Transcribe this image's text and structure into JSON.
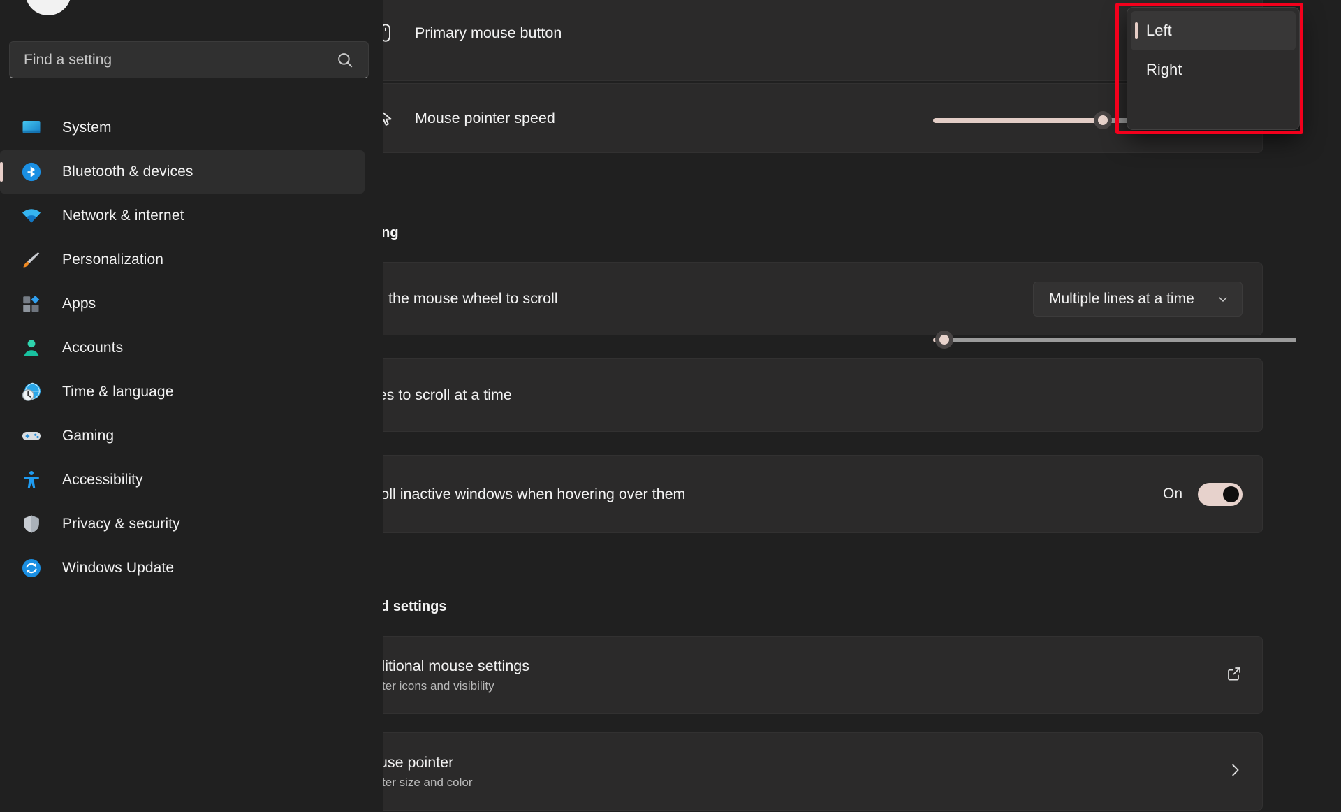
{
  "search": {
    "placeholder": "Find a setting",
    "value": "",
    "icon": "search-icon"
  },
  "sidebar": {
    "items": [
      {
        "label": "System",
        "icon": "system-icon",
        "active": false
      },
      {
        "label": "Bluetooth & devices",
        "icon": "bluetooth-icon",
        "active": true
      },
      {
        "label": "Network & internet",
        "icon": "network-icon",
        "active": false
      },
      {
        "label": "Personalization",
        "icon": "brush-icon",
        "active": false
      },
      {
        "label": "Apps",
        "icon": "apps-icon",
        "active": false
      },
      {
        "label": "Accounts",
        "icon": "account-icon",
        "active": false
      },
      {
        "label": "Time & language",
        "icon": "clock-globe-icon",
        "active": false
      },
      {
        "label": "Gaming",
        "icon": "gamepad-icon",
        "active": false
      },
      {
        "label": "Accessibility",
        "icon": "accessibility-icon",
        "active": false
      },
      {
        "label": "Privacy & security",
        "icon": "shield-icon",
        "active": false
      },
      {
        "label": "Windows Update",
        "icon": "update-icon",
        "active": false
      }
    ]
  },
  "main": {
    "primary_mouse_button": {
      "label": "Primary mouse button",
      "icon": "mouse-icon",
      "selected_value": "Left",
      "options": [
        "Left",
        "Right"
      ]
    },
    "pointer_speed": {
      "label": "Mouse pointer speed",
      "icon": "cursor-arrow-icon",
      "value_percent": 47
    },
    "scrolling_section": {
      "heading": "Scrolling",
      "wheel_scroll": {
        "label": "Roll the mouse wheel to scroll",
        "selected_value": "Multiple lines at a time"
      },
      "lines_to_scroll": {
        "label": "Lines to scroll at a time",
        "value_percent": 3
      },
      "inactive_windows": {
        "label": "Scroll inactive windows when hovering over them",
        "state": "On",
        "checked": true
      }
    },
    "related_section": {
      "heading": "Related settings",
      "items": [
        {
          "title": "Additional mouse settings",
          "subtitle": "Pointer icons and visibility",
          "affordance": "external-link-icon"
        },
        {
          "title": "Mouse pointer",
          "subtitle": "Pointer size and color",
          "affordance": "chevron-right-icon"
        }
      ]
    }
  },
  "annotation": {
    "color": "#f3001c",
    "target": "primary-mouse-button-dropdown"
  }
}
